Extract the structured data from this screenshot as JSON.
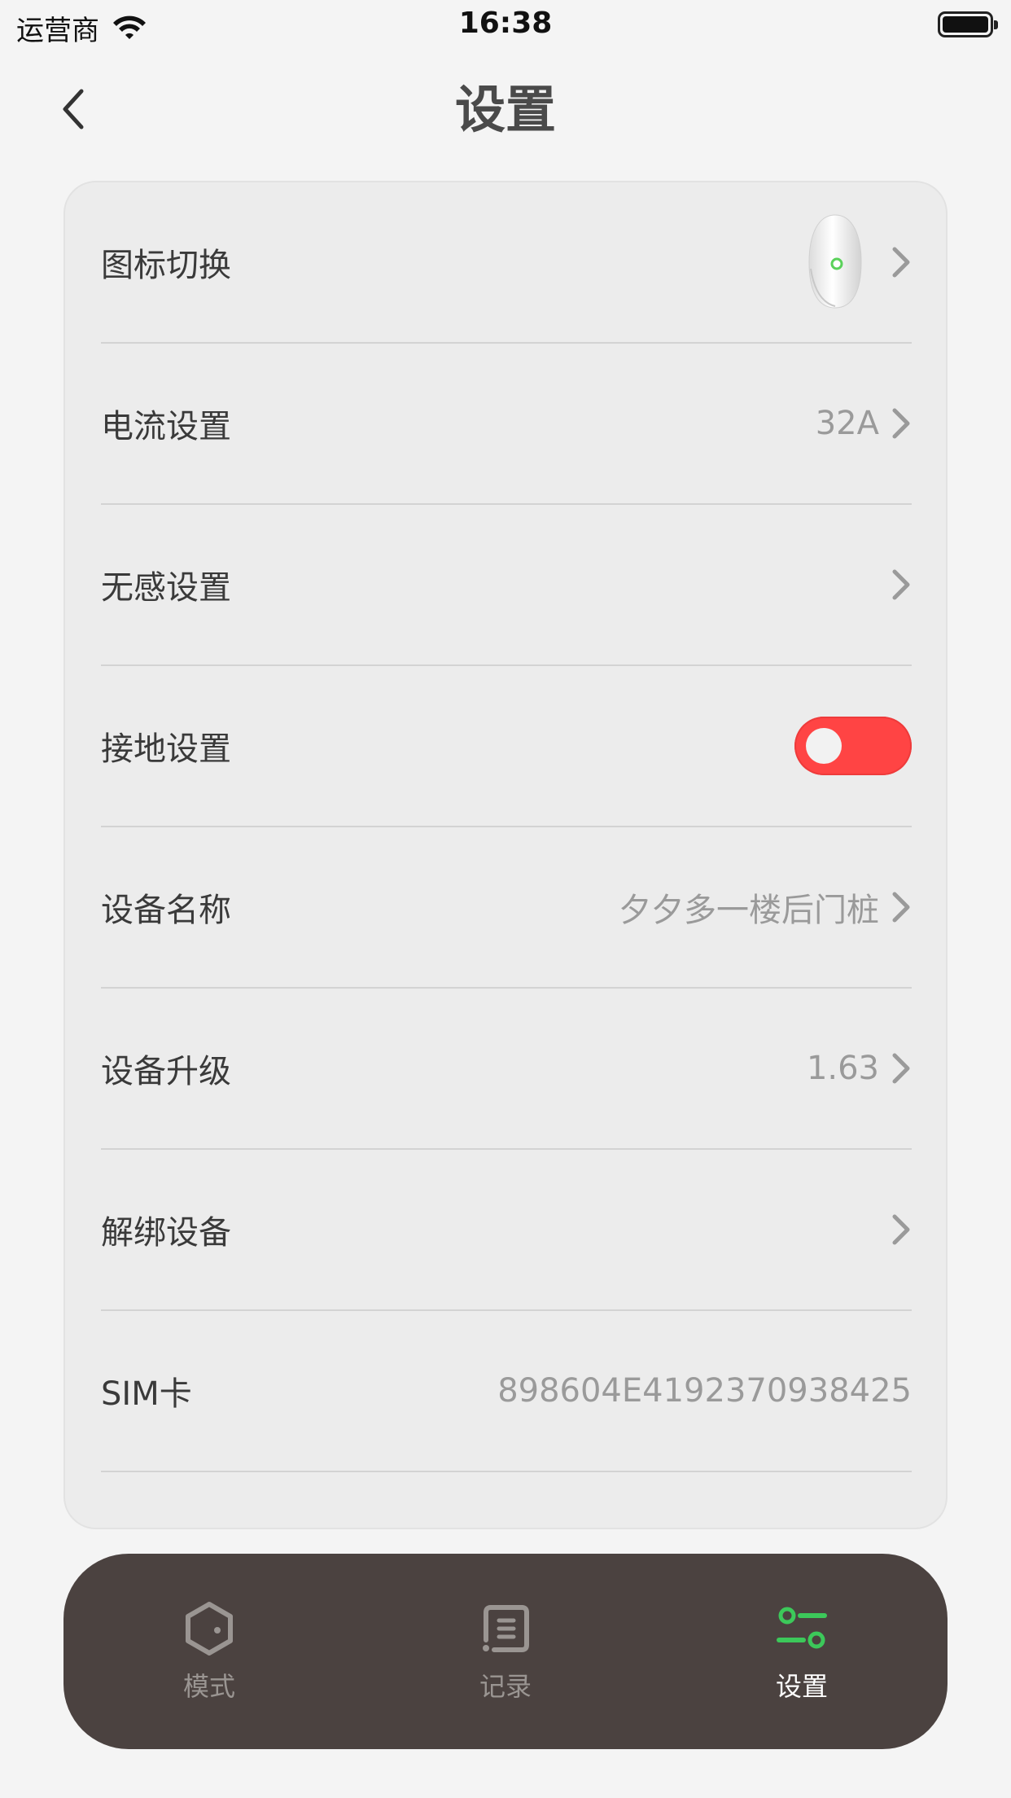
{
  "status_bar": {
    "carrier": "运营商",
    "time": "16:38"
  },
  "nav": {
    "title": "设置"
  },
  "settings": {
    "icon_switch": {
      "label": "图标切换"
    },
    "current": {
      "label": "电流设置",
      "value": "32A"
    },
    "seamless": {
      "label": "无感设置"
    },
    "grounding": {
      "label": "接地设置",
      "enabled": true
    },
    "device_name": {
      "label": "设备名称",
      "value": "夕夕多一楼后门桩"
    },
    "upgrade": {
      "label": "设备升级",
      "value": "1.63"
    },
    "unbind": {
      "label": "解绑设备"
    },
    "sim": {
      "label": "SIM卡",
      "value": "898604E4192370938425"
    }
  },
  "tabs": [
    {
      "label": "模式",
      "icon": "hexagon-mode-icon",
      "active": false
    },
    {
      "label": "记录",
      "icon": "record-list-icon",
      "active": false
    },
    {
      "label": "设置",
      "icon": "settings-sliders-icon",
      "active": true
    }
  ],
  "colors": {
    "toggle": "#ff4444",
    "tab_active_icon": "#3cc85a",
    "tab_bar": "#4b4240"
  }
}
